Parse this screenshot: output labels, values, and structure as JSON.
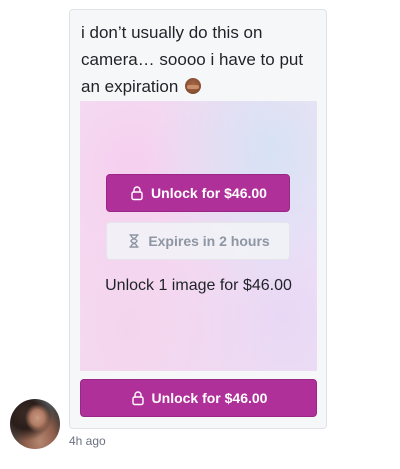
{
  "post": {
    "caption_text": "i don’t usually do this on camera… soooo i have to put an expiration",
    "caption_emoji": "see-no-evil-monkey-emoji",
    "unlock_overlay_label": "Unlock for $46.00",
    "expires_label": "Expires in 2 hours",
    "unlock_description": "Unlock 1 image for $46.00",
    "unlock_main_label": "Unlock for $46.00",
    "timestamp": "4h ago"
  },
  "colors": {
    "accent": "#b0309a",
    "bubble_bg": "#f6f7f9",
    "muted_text": "#8e95a3"
  },
  "icons": {
    "unlock": "lock-icon",
    "expires": "hourglass-icon"
  }
}
